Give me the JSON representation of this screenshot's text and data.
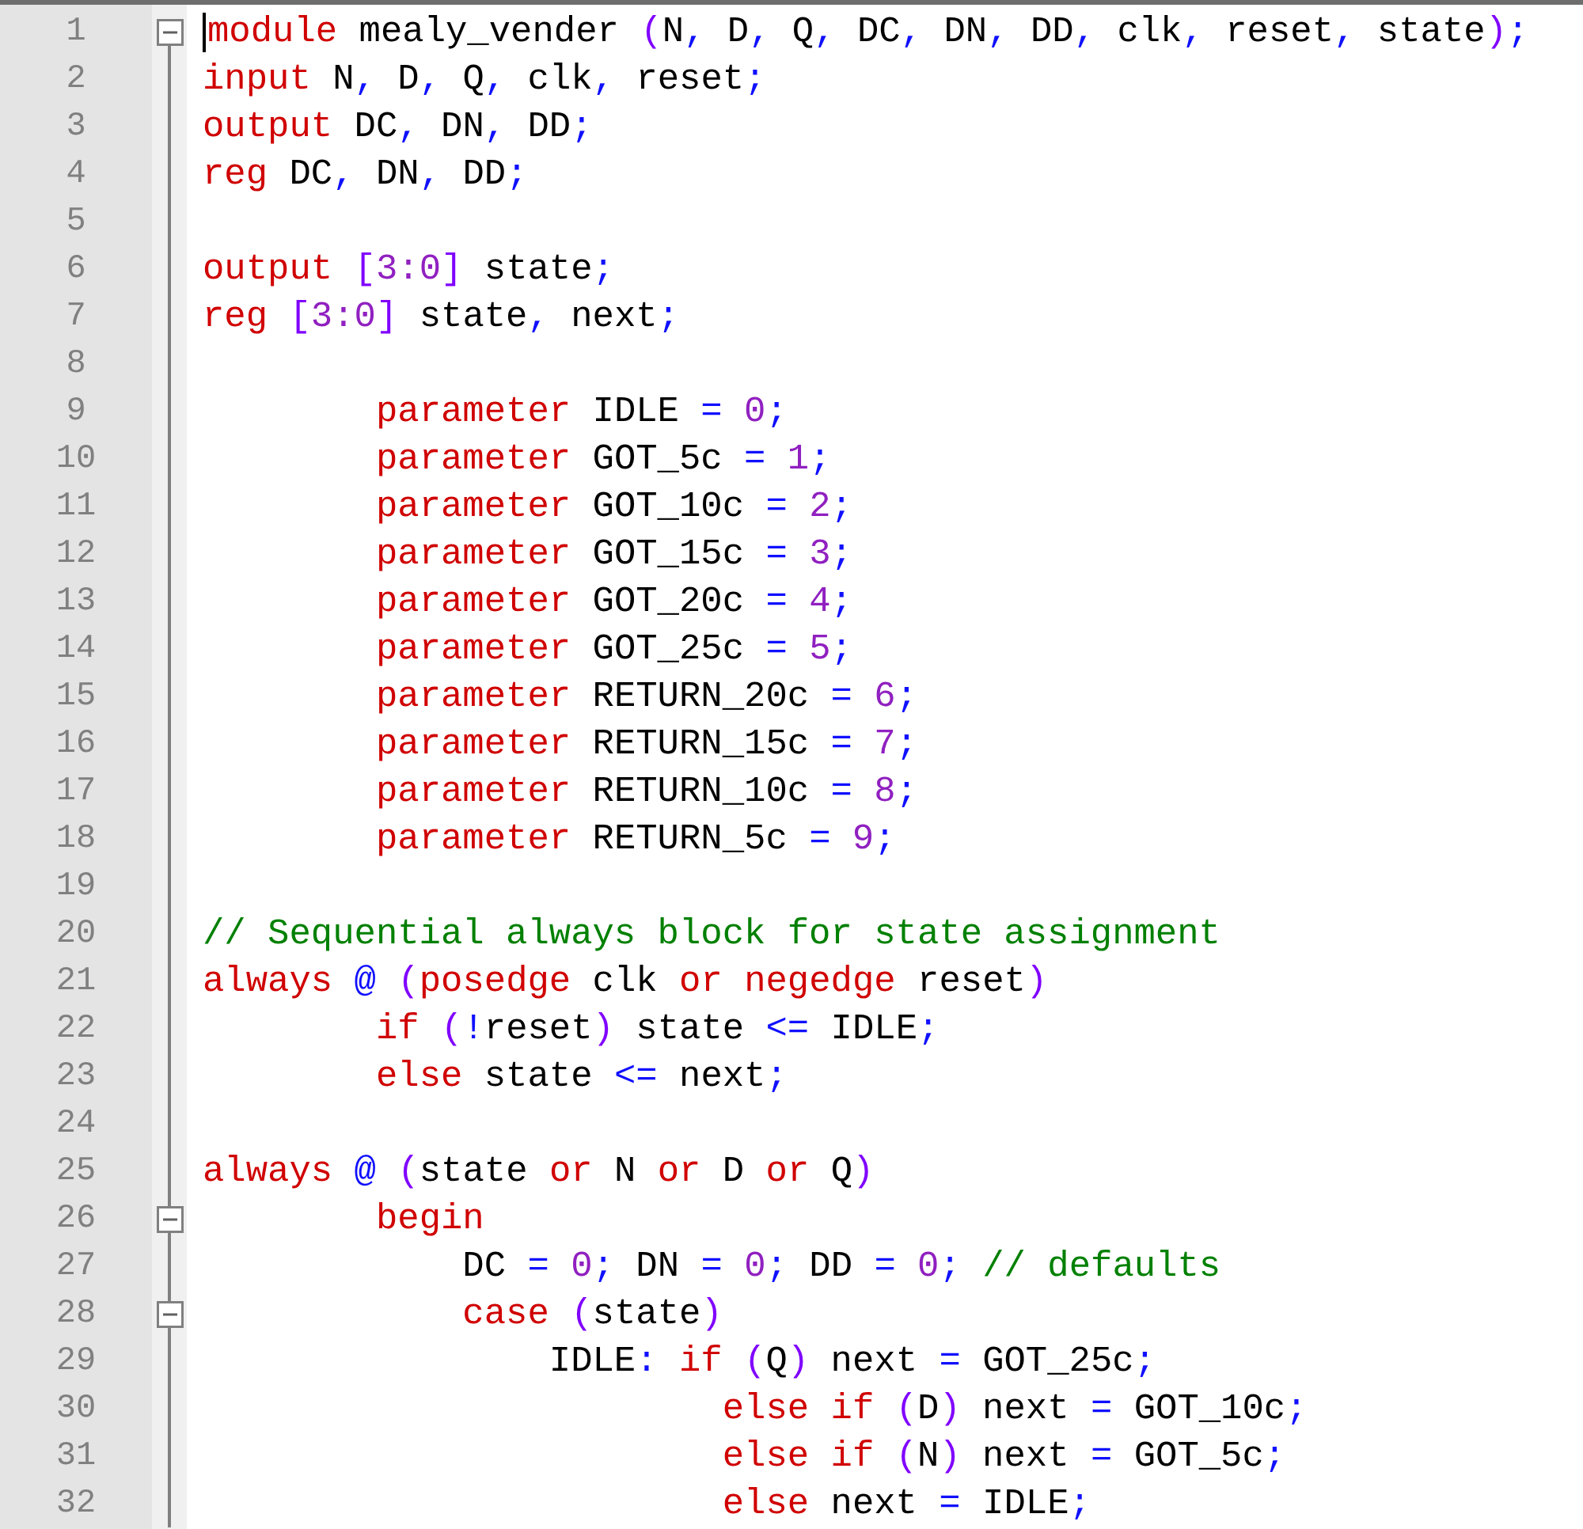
{
  "editor": {
    "lines": [
      {
        "number": "1",
        "fold_start": true,
        "caret": true,
        "tokens": [
          {
            "kind": "keyword",
            "text": "module"
          },
          {
            "kind": "ident",
            "text": " mealy_vender "
          },
          {
            "kind": "paren",
            "text": "("
          },
          {
            "kind": "ident",
            "text": "N"
          },
          {
            "kind": "punct",
            "text": ","
          },
          {
            "kind": "ident",
            "text": " D"
          },
          {
            "kind": "punct",
            "text": ","
          },
          {
            "kind": "ident",
            "text": " Q"
          },
          {
            "kind": "punct",
            "text": ","
          },
          {
            "kind": "ident",
            "text": " DC"
          },
          {
            "kind": "punct",
            "text": ","
          },
          {
            "kind": "ident",
            "text": " DN"
          },
          {
            "kind": "punct",
            "text": ","
          },
          {
            "kind": "ident",
            "text": " DD"
          },
          {
            "kind": "punct",
            "text": ","
          },
          {
            "kind": "ident",
            "text": " clk"
          },
          {
            "kind": "punct",
            "text": ","
          },
          {
            "kind": "ident",
            "text": " reset"
          },
          {
            "kind": "punct",
            "text": ","
          },
          {
            "kind": "ident",
            "text": " state"
          },
          {
            "kind": "paren",
            "text": ")"
          },
          {
            "kind": "punct",
            "text": ";"
          }
        ]
      },
      {
        "number": "2",
        "fold_start": false,
        "caret": false,
        "tokens": [
          {
            "kind": "keyword",
            "text": "input"
          },
          {
            "kind": "ident",
            "text": " N"
          },
          {
            "kind": "punct",
            "text": ","
          },
          {
            "kind": "ident",
            "text": " D"
          },
          {
            "kind": "punct",
            "text": ","
          },
          {
            "kind": "ident",
            "text": " Q"
          },
          {
            "kind": "punct",
            "text": ","
          },
          {
            "kind": "ident",
            "text": " clk"
          },
          {
            "kind": "punct",
            "text": ","
          },
          {
            "kind": "ident",
            "text": " reset"
          },
          {
            "kind": "punct",
            "text": ";"
          }
        ]
      },
      {
        "number": "3",
        "fold_start": false,
        "caret": false,
        "tokens": [
          {
            "kind": "keyword",
            "text": "output"
          },
          {
            "kind": "ident",
            "text": " DC"
          },
          {
            "kind": "punct",
            "text": ","
          },
          {
            "kind": "ident",
            "text": " DN"
          },
          {
            "kind": "punct",
            "text": ","
          },
          {
            "kind": "ident",
            "text": " DD"
          },
          {
            "kind": "punct",
            "text": ";"
          }
        ]
      },
      {
        "number": "4",
        "fold_start": false,
        "caret": false,
        "tokens": [
          {
            "kind": "keyword",
            "text": "reg"
          },
          {
            "kind": "ident",
            "text": " DC"
          },
          {
            "kind": "punct",
            "text": ","
          },
          {
            "kind": "ident",
            "text": " DN"
          },
          {
            "kind": "punct",
            "text": ","
          },
          {
            "kind": "ident",
            "text": " DD"
          },
          {
            "kind": "punct",
            "text": ";"
          }
        ]
      },
      {
        "number": "5",
        "fold_start": false,
        "caret": false
      },
      {
        "number": "6",
        "fold_start": false,
        "caret": false,
        "tokens": [
          {
            "kind": "keyword",
            "text": "output"
          },
          {
            "kind": "paren",
            "text": " ["
          },
          {
            "kind": "number",
            "text": "3:0"
          },
          {
            "kind": "paren",
            "text": "]"
          },
          {
            "kind": "ident",
            "text": " state"
          },
          {
            "kind": "punct",
            "text": ";"
          }
        ]
      },
      {
        "number": "7",
        "fold_start": false,
        "caret": false,
        "tokens": [
          {
            "kind": "keyword",
            "text": "reg"
          },
          {
            "kind": "paren",
            "text": " ["
          },
          {
            "kind": "number",
            "text": "3:0"
          },
          {
            "kind": "paren",
            "text": "]"
          },
          {
            "kind": "ident",
            "text": " state"
          },
          {
            "kind": "punct",
            "text": ","
          },
          {
            "kind": "ident",
            "text": " next"
          },
          {
            "kind": "punct",
            "text": ";"
          }
        ]
      },
      {
        "number": "8",
        "fold_start": false,
        "caret": false
      },
      {
        "number": "9",
        "fold_start": false,
        "caret": false,
        "tokens": [
          {
            "kind": "keyword",
            "text": "        parameter"
          },
          {
            "kind": "ident",
            "text": " IDLE "
          },
          {
            "kind": "punct",
            "text": "="
          },
          {
            "kind": "number",
            "text": " 0"
          },
          {
            "kind": "punct",
            "text": ";"
          }
        ]
      },
      {
        "number": "10",
        "fold_start": false,
        "caret": false,
        "tokens": [
          {
            "kind": "keyword",
            "text": "        parameter"
          },
          {
            "kind": "ident",
            "text": " GOT_5c "
          },
          {
            "kind": "punct",
            "text": "="
          },
          {
            "kind": "number",
            "text": " 1"
          },
          {
            "kind": "punct",
            "text": ";"
          }
        ]
      },
      {
        "number": "11",
        "fold_start": false,
        "caret": false,
        "tokens": [
          {
            "kind": "keyword",
            "text": "        parameter"
          },
          {
            "kind": "ident",
            "text": " GOT_10c "
          },
          {
            "kind": "punct",
            "text": "="
          },
          {
            "kind": "number",
            "text": " 2"
          },
          {
            "kind": "punct",
            "text": ";"
          }
        ]
      },
      {
        "number": "12",
        "fold_start": false,
        "caret": false,
        "tokens": [
          {
            "kind": "keyword",
            "text": "        parameter"
          },
          {
            "kind": "ident",
            "text": " GOT_15c "
          },
          {
            "kind": "punct",
            "text": "="
          },
          {
            "kind": "number",
            "text": " 3"
          },
          {
            "kind": "punct",
            "text": ";"
          }
        ]
      },
      {
        "number": "13",
        "fold_start": false,
        "caret": false,
        "tokens": [
          {
            "kind": "keyword",
            "text": "        parameter"
          },
          {
            "kind": "ident",
            "text": " GOT_20c "
          },
          {
            "kind": "punct",
            "text": "="
          },
          {
            "kind": "number",
            "text": " 4"
          },
          {
            "kind": "punct",
            "text": ";"
          }
        ]
      },
      {
        "number": "14",
        "fold_start": false,
        "caret": false,
        "tokens": [
          {
            "kind": "keyword",
            "text": "        parameter"
          },
          {
            "kind": "ident",
            "text": " GOT_25c "
          },
          {
            "kind": "punct",
            "text": "="
          },
          {
            "kind": "number",
            "text": " 5"
          },
          {
            "kind": "punct",
            "text": ";"
          }
        ]
      },
      {
        "number": "15",
        "fold_start": false,
        "caret": false,
        "tokens": [
          {
            "kind": "keyword",
            "text": "        parameter"
          },
          {
            "kind": "ident",
            "text": " RETURN_20c "
          },
          {
            "kind": "punct",
            "text": "="
          },
          {
            "kind": "number",
            "text": " 6"
          },
          {
            "kind": "punct",
            "text": ";"
          }
        ]
      },
      {
        "number": "16",
        "fold_start": false,
        "caret": false,
        "tokens": [
          {
            "kind": "keyword",
            "text": "        parameter"
          },
          {
            "kind": "ident",
            "text": " RETURN_15c "
          },
          {
            "kind": "punct",
            "text": "="
          },
          {
            "kind": "number",
            "text": " 7"
          },
          {
            "kind": "punct",
            "text": ";"
          }
        ]
      },
      {
        "number": "17",
        "fold_start": false,
        "caret": false,
        "tokens": [
          {
            "kind": "keyword",
            "text": "        parameter"
          },
          {
            "kind": "ident",
            "text": " RETURN_10c "
          },
          {
            "kind": "punct",
            "text": "="
          },
          {
            "kind": "number",
            "text": " 8"
          },
          {
            "kind": "punct",
            "text": ";"
          }
        ]
      },
      {
        "number": "18",
        "fold_start": false,
        "caret": false,
        "tokens": [
          {
            "kind": "keyword",
            "text": "        parameter"
          },
          {
            "kind": "ident",
            "text": " RETURN_5c "
          },
          {
            "kind": "punct",
            "text": "="
          },
          {
            "kind": "number",
            "text": " 9"
          },
          {
            "kind": "punct",
            "text": ";"
          }
        ]
      },
      {
        "number": "19",
        "fold_start": false,
        "caret": false
      },
      {
        "number": "20",
        "fold_start": false,
        "caret": false,
        "tokens": [
          {
            "kind": "comment",
            "text": "// Sequential always block for state assignment"
          }
        ]
      },
      {
        "number": "21",
        "fold_start": false,
        "caret": false,
        "tokens": [
          {
            "kind": "keyword",
            "text": "always"
          },
          {
            "kind": "punct",
            "text": " @"
          },
          {
            "kind": "paren",
            "text": " ("
          },
          {
            "kind": "keyword",
            "text": "posedge"
          },
          {
            "kind": "ident",
            "text": " clk "
          },
          {
            "kind": "keyword",
            "text": "or"
          },
          {
            "kind": "keyword",
            "text": " negedge"
          },
          {
            "kind": "ident",
            "text": " reset"
          },
          {
            "kind": "paren",
            "text": ")"
          }
        ]
      },
      {
        "number": "22",
        "fold_start": false,
        "caret": false,
        "tokens": [
          {
            "kind": "keyword",
            "text": "        if"
          },
          {
            "kind": "paren",
            "text": " ("
          },
          {
            "kind": "punct",
            "text": "!"
          },
          {
            "kind": "ident",
            "text": "reset"
          },
          {
            "kind": "paren",
            "text": ")"
          },
          {
            "kind": "ident",
            "text": " state "
          },
          {
            "kind": "punct",
            "text": "<="
          },
          {
            "kind": "ident",
            "text": " IDLE"
          },
          {
            "kind": "punct",
            "text": ";"
          }
        ]
      },
      {
        "number": "23",
        "fold_start": false,
        "caret": false,
        "tokens": [
          {
            "kind": "keyword",
            "text": "        else"
          },
          {
            "kind": "ident",
            "text": " state "
          },
          {
            "kind": "punct",
            "text": "<="
          },
          {
            "kind": "ident",
            "text": " next"
          },
          {
            "kind": "punct",
            "text": ";"
          }
        ]
      },
      {
        "number": "24",
        "fold_start": false,
        "caret": false
      },
      {
        "number": "25",
        "fold_start": false,
        "caret": false,
        "tokens": [
          {
            "kind": "keyword",
            "text": "always"
          },
          {
            "kind": "punct",
            "text": " @"
          },
          {
            "kind": "paren",
            "text": " ("
          },
          {
            "kind": "ident",
            "text": "state "
          },
          {
            "kind": "keyword",
            "text": "or"
          },
          {
            "kind": "ident",
            "text": " N "
          },
          {
            "kind": "keyword",
            "text": "or"
          },
          {
            "kind": "ident",
            "text": " D "
          },
          {
            "kind": "keyword",
            "text": "or"
          },
          {
            "kind": "ident",
            "text": " Q"
          },
          {
            "kind": "paren",
            "text": ")"
          }
        ]
      },
      {
        "number": "26",
        "fold_start": true,
        "caret": false,
        "tokens": [
          {
            "kind": "keyword",
            "text": "        begin"
          }
        ]
      },
      {
        "number": "27",
        "fold_start": false,
        "caret": false,
        "tokens": [
          {
            "kind": "ident",
            "text": "            DC "
          },
          {
            "kind": "punct",
            "text": "="
          },
          {
            "kind": "number",
            "text": " 0"
          },
          {
            "kind": "punct",
            "text": ";"
          },
          {
            "kind": "ident",
            "text": " DN "
          },
          {
            "kind": "punct",
            "text": "="
          },
          {
            "kind": "number",
            "text": " 0"
          },
          {
            "kind": "punct",
            "text": ";"
          },
          {
            "kind": "ident",
            "text": " DD "
          },
          {
            "kind": "punct",
            "text": "="
          },
          {
            "kind": "number",
            "text": " 0"
          },
          {
            "kind": "punct",
            "text": ";"
          },
          {
            "kind": "comment",
            "text": " // defaults"
          }
        ]
      },
      {
        "number": "28",
        "fold_start": true,
        "caret": false,
        "tokens": [
          {
            "kind": "keyword",
            "text": "            case"
          },
          {
            "kind": "paren",
            "text": " ("
          },
          {
            "kind": "ident",
            "text": "state"
          },
          {
            "kind": "paren",
            "text": ")"
          }
        ]
      },
      {
        "number": "29",
        "fold_start": false,
        "caret": false,
        "tokens": [
          {
            "kind": "ident",
            "text": "                IDLE"
          },
          {
            "kind": "punct",
            "text": ":"
          },
          {
            "kind": "keyword",
            "text": " if"
          },
          {
            "kind": "paren",
            "text": " ("
          },
          {
            "kind": "ident",
            "text": "Q"
          },
          {
            "kind": "paren",
            "text": ")"
          },
          {
            "kind": "ident",
            "text": " next "
          },
          {
            "kind": "punct",
            "text": "="
          },
          {
            "kind": "ident",
            "text": " GOT_25c"
          },
          {
            "kind": "punct",
            "text": ";"
          }
        ]
      },
      {
        "number": "30",
        "fold_start": false,
        "caret": false,
        "tokens": [
          {
            "kind": "keyword",
            "text": "                        else"
          },
          {
            "kind": "keyword",
            "text": " if"
          },
          {
            "kind": "paren",
            "text": " ("
          },
          {
            "kind": "ident",
            "text": "D"
          },
          {
            "kind": "paren",
            "text": ")"
          },
          {
            "kind": "ident",
            "text": " next "
          },
          {
            "kind": "punct",
            "text": "="
          },
          {
            "kind": "ident",
            "text": " GOT_10c"
          },
          {
            "kind": "punct",
            "text": ";"
          }
        ]
      },
      {
        "number": "31",
        "fold_start": false,
        "caret": false,
        "tokens": [
          {
            "kind": "keyword",
            "text": "                        else"
          },
          {
            "kind": "keyword",
            "text": " if"
          },
          {
            "kind": "paren",
            "text": " ("
          },
          {
            "kind": "ident",
            "text": "N"
          },
          {
            "kind": "paren",
            "text": ")"
          },
          {
            "kind": "ident",
            "text": " next "
          },
          {
            "kind": "punct",
            "text": "="
          },
          {
            "kind": "ident",
            "text": " GOT_5c"
          },
          {
            "kind": "punct",
            "text": ";"
          }
        ]
      },
      {
        "number": "32",
        "fold_start": false,
        "caret": false,
        "tokens": [
          {
            "kind": "keyword",
            "text": "                        else"
          },
          {
            "kind": "ident",
            "text": " next "
          },
          {
            "kind": "punct",
            "text": "="
          },
          {
            "kind": "ident",
            "text": " IDLE"
          },
          {
            "kind": "punct",
            "text": ";"
          }
        ]
      }
    ]
  }
}
